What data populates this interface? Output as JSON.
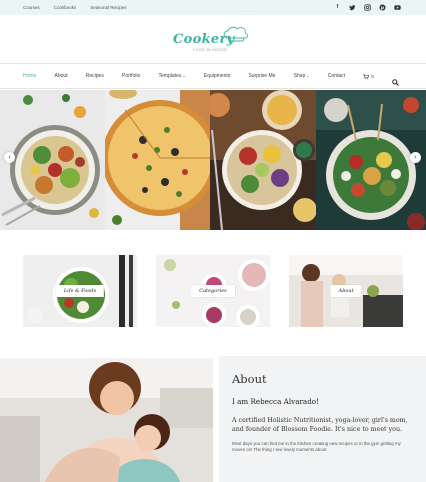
{
  "topbar": {
    "links": [
      "Courses",
      "Cookbooks",
      "Seasonal Recipes"
    ],
    "socials": [
      "facebook-icon",
      "twitter-icon",
      "instagram-icon",
      "pinterest-icon",
      "youtube-icon"
    ]
  },
  "logo": {
    "name": "Cookery",
    "tagline": "FOOD BLOGGER"
  },
  "nav": {
    "items": [
      "Home",
      "About",
      "Recipes",
      "Portfolio",
      "Templates",
      "Equipments",
      "Surprise Me",
      "Shop",
      "Contact"
    ],
    "cart_count": "0"
  },
  "categories": [
    {
      "label": "Life & Foods"
    },
    {
      "label": "Categories"
    },
    {
      "label": "About"
    }
  ],
  "about": {
    "heading": "About",
    "greeting": "I am Rebecca Alvarado!",
    "intro": "A certified Holistic Nutritionist, yoga-lover, girl's mom, and founder of Blossom Foodie. It's nice to meet you.",
    "body": "Most days you can find me in the kitchen creating new recipes or in the gym getting my moves on! The thing I see lovely moments about"
  },
  "colors": {
    "accent": "#3eb59f",
    "topbar_bg": "#eaf6f4",
    "about_bg": "#f2f3f4"
  }
}
